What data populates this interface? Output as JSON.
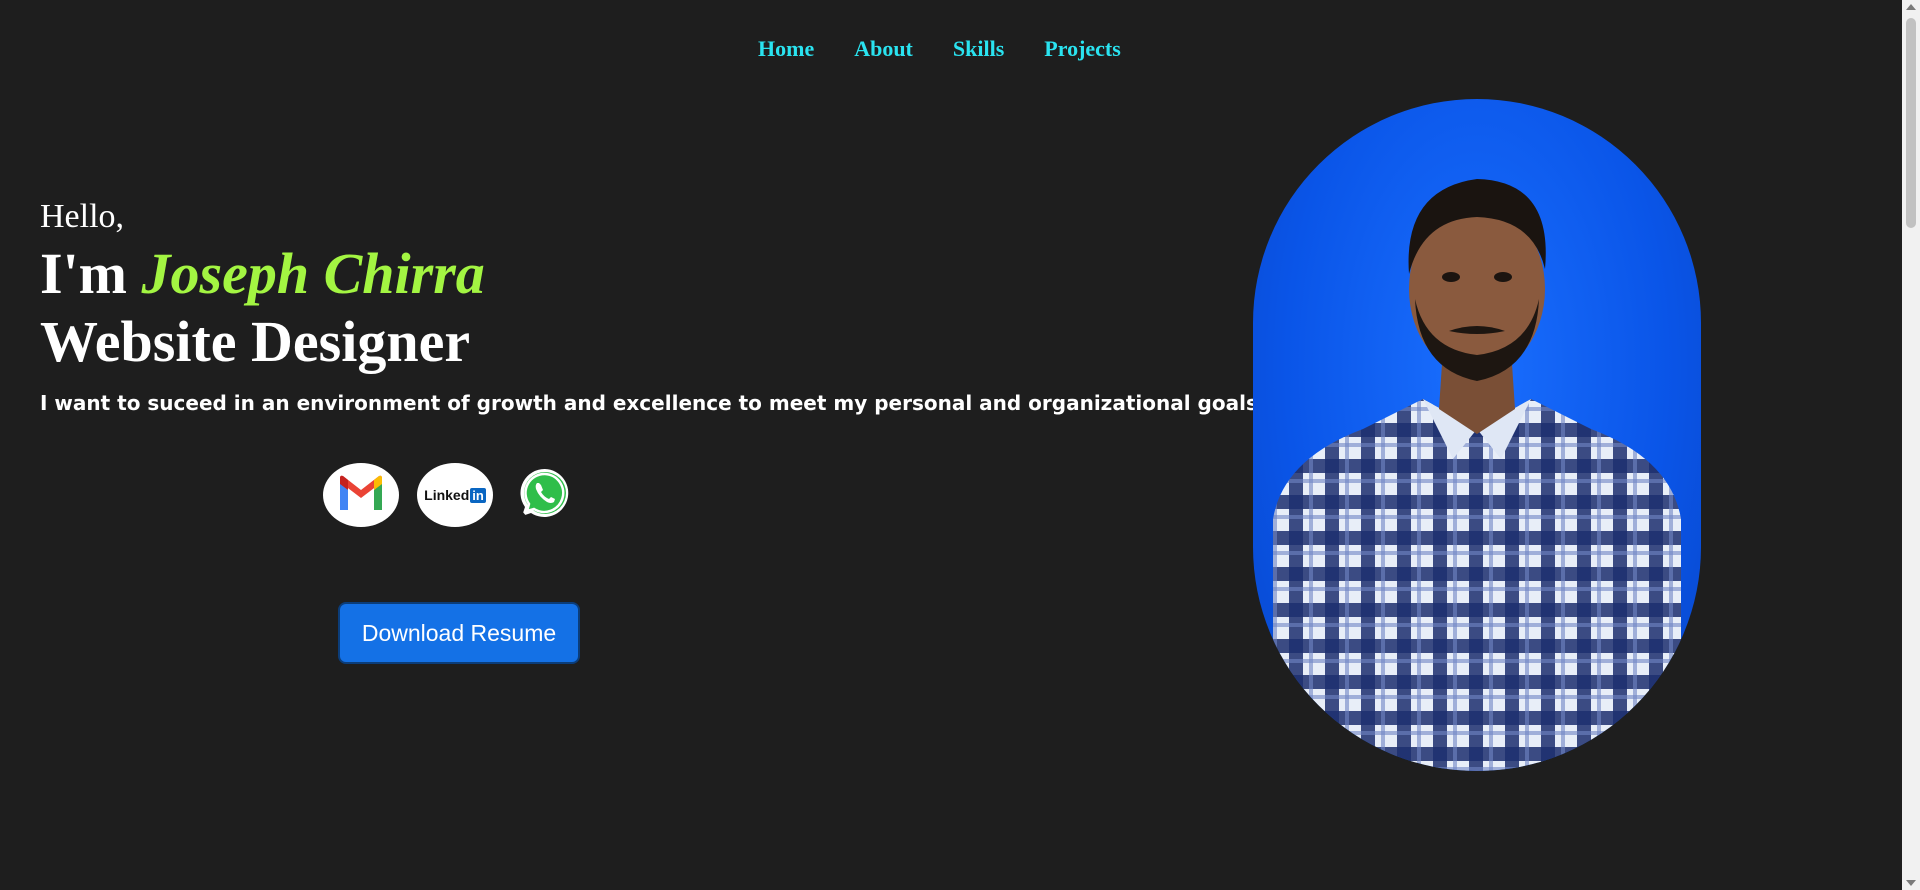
{
  "nav": {
    "items": [
      {
        "label": "Home"
      },
      {
        "label": "About"
      },
      {
        "label": "Skills"
      },
      {
        "label": "Projects"
      }
    ]
  },
  "hero": {
    "greeting": "Hello,",
    "im_prefix": "I'm ",
    "name": "Joseph Chirra",
    "role": "Website Designer",
    "objective": "I want to suceed in an environment of growth and excellence to meet my personal and organizational goals"
  },
  "social": {
    "items": [
      {
        "icon": "gmail-icon"
      },
      {
        "icon": "linkedin-icon",
        "text_main": "Linked",
        "text_in": "in"
      },
      {
        "icon": "whatsapp-icon"
      }
    ]
  },
  "cta": {
    "download_label": "Download Resume"
  },
  "colors": {
    "background": "#1e1e1e",
    "nav_link": "#2ae3f0",
    "name_accent": "#a3f542",
    "button": "#1471e6",
    "portrait_bg": "#0a55e8"
  }
}
